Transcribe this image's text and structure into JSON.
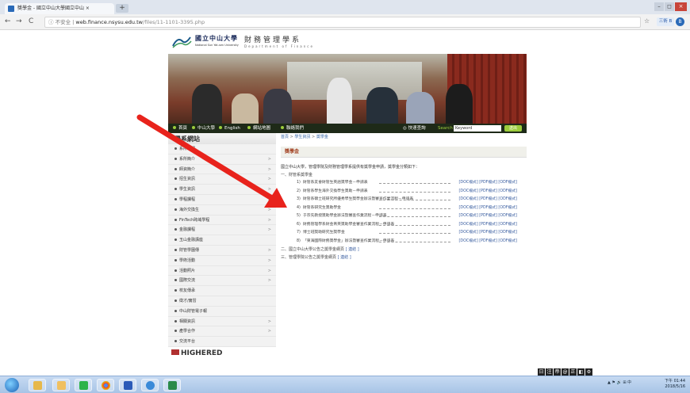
{
  "browser": {
    "tab_title": "獎學金 - 國立中山大學國立中山 ×",
    "tab_close": "×",
    "new_tab": "+",
    "address_security": "不安全",
    "address_host": "web.finance.nsysu.edu.tw",
    "address_path": "/files/11-1101-3395.php",
    "user_chip": "三術 B",
    "avatar_letter": "B",
    "nav_back": "←",
    "nav_forward": "→",
    "nav_reload": "C",
    "info_icon": "ⓘ",
    "star": "☆"
  },
  "site": {
    "university_cn": "國立中山大學",
    "university_en": "National Sun Yat-sen University",
    "dept_cn": "財務管理學系",
    "dept_en": "Department of Finance"
  },
  "menubar": {
    "items": [
      "首頁",
      "中山大學",
      "English",
      "網站地圖",
      "聯絡我們"
    ],
    "quick_search": "快速查詢",
    "search_label": "Search",
    "search_value": "Keyword",
    "go_label": "送出"
  },
  "sidebar": {
    "heading": "學系網站",
    "items": [
      {
        "label": "系所介紹",
        "arrow": ""
      },
      {
        "label": "系所簡介",
        "arrow": ">"
      },
      {
        "label": "師資簡介",
        "arrow": ">"
      },
      {
        "label": "招生資訊",
        "arrow": ">"
      },
      {
        "label": "學生資訊",
        "arrow": ">"
      },
      {
        "label": "學程課程",
        "arrow": ">"
      },
      {
        "label": "海外交換生",
        "arrow": ">"
      },
      {
        "label": "FinTech跨域學程",
        "arrow": ">"
      },
      {
        "label": "金融課程",
        "arrow": ">"
      },
      {
        "label": "玉山金融講座",
        "arrow": ""
      },
      {
        "label": "財管學園傳",
        "arrow": ">"
      },
      {
        "label": "學術活動",
        "arrow": ">"
      },
      {
        "label": "活動照片",
        "arrow": ">"
      },
      {
        "label": "國際交流",
        "arrow": ">"
      },
      {
        "label": "校友傳承",
        "arrow": ""
      },
      {
        "label": "徵才/實習",
        "arrow": ""
      },
      {
        "label": "中山財管電子報",
        "arrow": ""
      },
      {
        "label": "相關資訊",
        "arrow": ">"
      },
      {
        "label": "產學合作",
        "arrow": ">"
      },
      {
        "label": "交流平台",
        "arrow": ""
      }
    ],
    "footer_logo": "HIGHERED"
  },
  "main": {
    "breadcrumb": [
      "首頁",
      "學生資訊",
      "獎學金"
    ],
    "crumb_sep": ">",
    "page_title": "獎學金",
    "intro": "國立中山大學，管理學院及財務管理學系提供有獎學金申請，獎學金分類如下：",
    "section_one": "一、財管系獎學金",
    "docs": [
      {
        "no": "1)",
        "title": "財管系友會財管生英語獎學金－申請表",
        "formats": "[DOC檔式] [PDF檔式] [ODF檔式]"
      },
      {
        "no": "2)",
        "title": "財管系學生海外交換學生獎助－申請表",
        "formats": "[DOC檔式] [PDF檔式] [ODF檔式]"
      },
      {
        "no": "3)",
        "title": "財管系碩士班研究所優秀學生獎學金辦法暨審查作業流程－申請表",
        "formats": "[DOC檔式] [PDF檔式] [ODF檔式]"
      },
      {
        "no": "4)",
        "title": "財管系研究生獎助學金",
        "formats": "[DOC檔式] [PDF檔式] [ODF檔式]"
      },
      {
        "no": "5)",
        "title": "于宗先教授獎助學金辦法暨審查作業流程－申請表",
        "formats": "[DOC檔式] [PDF檔式] [ODF檔式]"
      },
      {
        "no": "6)",
        "title": "財務管理學系財金菁英獎助學金審查作業流程－申請表",
        "formats": "[DOC檔式] [PDF檔式] [ODF檔式]"
      },
      {
        "no": "7)",
        "title": "博士班獎助研究生獎學金",
        "formats": "[DOC檔式] [PDF檔式] [ODF檔式]"
      },
      {
        "no": "8)",
        "title": "「東海國際財務獎學金」辦法暨審查作業流程－申請表",
        "formats": "[DOC檔式] [PDF檔式] [ODF檔式]"
      }
    ],
    "section_two": "二、國立中山大學公告之獎學金網頁",
    "section_two_link": "[ 連結 ]",
    "section_three": "三、管理學院公告之獎學金網頁",
    "section_three_link": "[ 連結 ]"
  },
  "ime_toolbar": [
    "日",
    "注",
    "帝",
    "@",
    "正",
    "◧",
    "⚙"
  ],
  "taskbar": {
    "clock_time": "下午 01:44",
    "clock_date": "2018/5/16",
    "tray_text": "▲ ⚑ 🔊 ⊞ 中"
  },
  "colors": {
    "accent_green": "#9ccc3c",
    "title_red": "#a03c1c",
    "link_blue": "#3a5ea0",
    "arrow_red": "#e8231c"
  }
}
